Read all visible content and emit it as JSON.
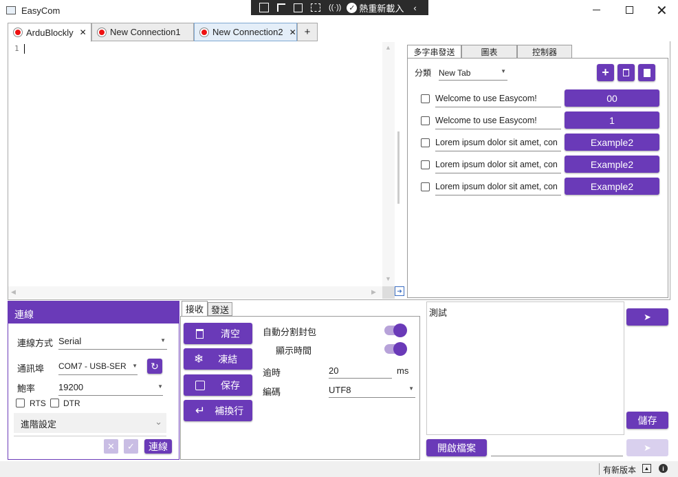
{
  "window": {
    "title": "EasyCom",
    "hot_reload": "熱重新載入"
  },
  "tabs": [
    {
      "label": "ArduBlockly"
    },
    {
      "label": "New Connection1"
    },
    {
      "label": "New Connection2"
    }
  ],
  "editor": {
    "line_number": "1"
  },
  "right_tabs": [
    "多字串發送",
    "圖表",
    "控制器"
  ],
  "category": {
    "label": "分類",
    "value": "New Tab"
  },
  "rows": [
    {
      "text": "Welcome to use Easycom!",
      "button": "00"
    },
    {
      "text": "Welcome to use Easycom!",
      "button": "1"
    },
    {
      "text": "Lorem ipsum dolor sit amet, con",
      "button": "Example2"
    },
    {
      "text": "Lorem ipsum dolor sit amet, con",
      "button": "Example2"
    },
    {
      "text": "Lorem ipsum dolor sit amet, con",
      "button": "Example2"
    }
  ],
  "connection": {
    "header": "連線",
    "method_label": "連線方式",
    "method_value": "Serial",
    "port_label": "通訊埠",
    "port_value": "COM7 - USB-SER",
    "baud_label": "鮑率",
    "baud_value": "19200",
    "rts": "RTS",
    "dtr": "DTR",
    "advanced": "進階設定",
    "connect_button": "連線"
  },
  "mid_tabs": {
    "receive": "接收",
    "send": "發送"
  },
  "actions": {
    "clear": "清空",
    "freeze": "凍結",
    "save": "保存",
    "newline": "補換行"
  },
  "options": {
    "auto_split": "自動分割封包",
    "show_time": "顯示時間",
    "timeout_label": "逾時",
    "timeout_value": "20",
    "timeout_unit": "ms",
    "encoding_label": "編碼",
    "encoding_value": "UTF8"
  },
  "send_area": {
    "text": "測試",
    "store_button": "儲存",
    "open_file_button": "開啟檔案"
  },
  "status": {
    "new_version": "有新版本"
  },
  "colors": {
    "accent": "#6a3ab8",
    "record": "#e11111"
  }
}
